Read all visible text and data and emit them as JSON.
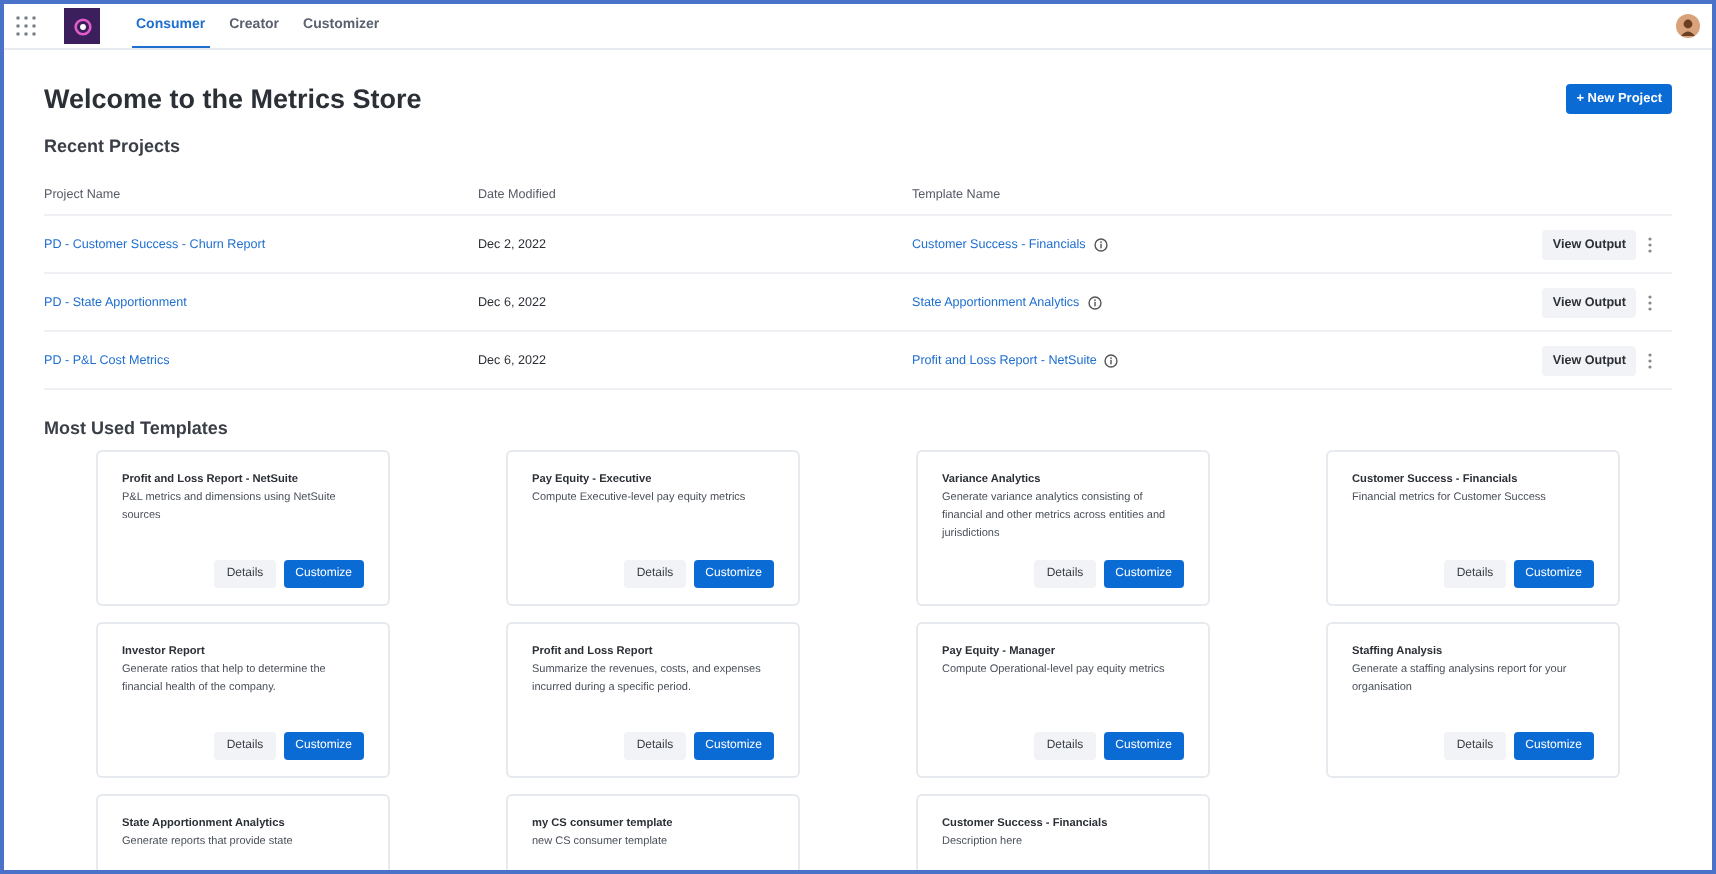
{
  "nav": {
    "tabs": [
      {
        "label": "Consumer",
        "selected": true
      },
      {
        "label": "Creator",
        "selected": false
      },
      {
        "label": "Customizer",
        "selected": false
      }
    ]
  },
  "title": "Welcome to the Metrics Store",
  "new_project_button": "+ New Project",
  "recent_projects": {
    "heading": "Recent Projects",
    "columns": [
      "Project Name",
      "Date Modified",
      "Template Name"
    ],
    "rows": [
      {
        "project": "PD - Customer Success - Churn Report",
        "date": "Dec 2, 2022",
        "template": "Customer Success - Financials",
        "action": "View Output"
      },
      {
        "project": "PD - State Apportionment",
        "date": "Dec 6, 2022",
        "template": "State Apportionment Analytics",
        "action": "View Output"
      },
      {
        "project": "PD - P&L Cost Metrics",
        "date": "Dec 6, 2022",
        "template": "Profit and Loss Report - NetSuite",
        "action": "View Output"
      }
    ]
  },
  "templates": {
    "heading": "Most Used Templates",
    "cards": [
      {
        "title": "Profit and Loss Report - NetSuite",
        "description": "P&L metrics and dimensions using NetSuite sources",
        "buttons": [
          "Details",
          "Customize"
        ]
      },
      {
        "title": "Pay Equity - Executive",
        "description": "Compute Executive-level pay equity metrics",
        "buttons": [
          "Details",
          "Customize"
        ]
      },
      {
        "title": "Variance Analytics",
        "description": "Generate variance analytics consisting of financial and other metrics across entities and jurisdictions",
        "buttons": [
          "Details",
          "Customize"
        ]
      },
      {
        "title": "Customer Success - Financials",
        "description": "Financial metrics for Customer Success",
        "buttons": [
          "Details",
          "Customize"
        ]
      },
      {
        "title": "Investor Report",
        "description": "Generate ratios that help to determine the financial health of the company.",
        "buttons": [
          "Details",
          "Customize"
        ]
      },
      {
        "title": "Profit and Loss Report",
        "description": "Summarize the revenues, costs, and expenses incurred during a specific period.",
        "buttons": [
          "Details",
          "Customize"
        ]
      },
      {
        "title": "Pay Equity - Manager",
        "description": "Compute Operational-level pay equity metrics",
        "buttons": [
          "Details",
          "Customize"
        ]
      },
      {
        "title": "Staffing Analysis",
        "description": "Generate a staffing analysins report for your organisation",
        "buttons": [
          "Details",
          "Customize"
        ]
      },
      {
        "title": "State Apportionment Analytics",
        "description": "Generate reports that provide state"
      },
      {
        "title": "my CS consumer template",
        "description": "new CS consumer template"
      },
      {
        "title": "Customer Success - Financials",
        "description": "Description here"
      }
    ]
  }
}
